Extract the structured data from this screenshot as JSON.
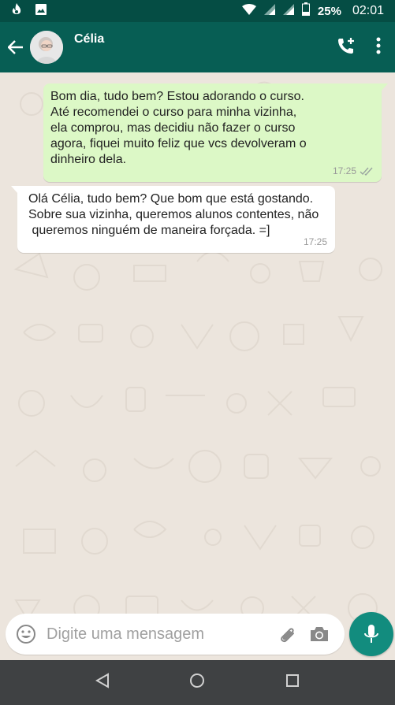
{
  "status_bar": {
    "battery_percent": "25%",
    "time": "02:01",
    "icons": [
      "fire-notification-icon",
      "image-notification-icon",
      "wifi-icon",
      "signal-icon",
      "signal-icon",
      "battery-icon"
    ]
  },
  "header": {
    "contact_name": "Célia",
    "icons": [
      "back-arrow-icon",
      "avatar",
      "add-call-icon",
      "more-vert-icon"
    ]
  },
  "messages": [
    {
      "direction": "outgoing",
      "lines": [
        "Bom dia, tudo bem? Estou adorando o curso.",
        "Até recomendei o curso para minha vizinha,",
        "ela comprou, mas decidiu não fazer o curso",
        "agora, fiquei muito feliz que vcs devolveram o",
        "dinheiro dela."
      ],
      "time": "17:25",
      "status_icon": "double-check-icon"
    },
    {
      "direction": "incoming",
      "lines": [
        "Olá Célia, tudo bem? Que bom que está gostando.",
        "Sobre sua vizinha, queremos alunos contentes, não",
        " queremos ninguém de maneira forçada. =]"
      ],
      "time": "17:25"
    }
  ],
  "composer": {
    "placeholder": "Digite uma mensagem",
    "value": "",
    "icons": [
      "emoji-icon",
      "paperclip-icon",
      "camera-icon",
      "mic-icon"
    ]
  },
  "colors": {
    "header": "#075e54",
    "status_bar": "#054d44",
    "outgoing_bubble": "#dcf8c6",
    "incoming_bubble": "#ffffff",
    "chat_background": "#ece5dd",
    "fab": "#128c7e",
    "nav_bar": "#3f4143"
  },
  "nav_bar": {
    "icons": [
      "back-triangle-icon",
      "home-circle-icon",
      "recents-square-icon"
    ]
  }
}
